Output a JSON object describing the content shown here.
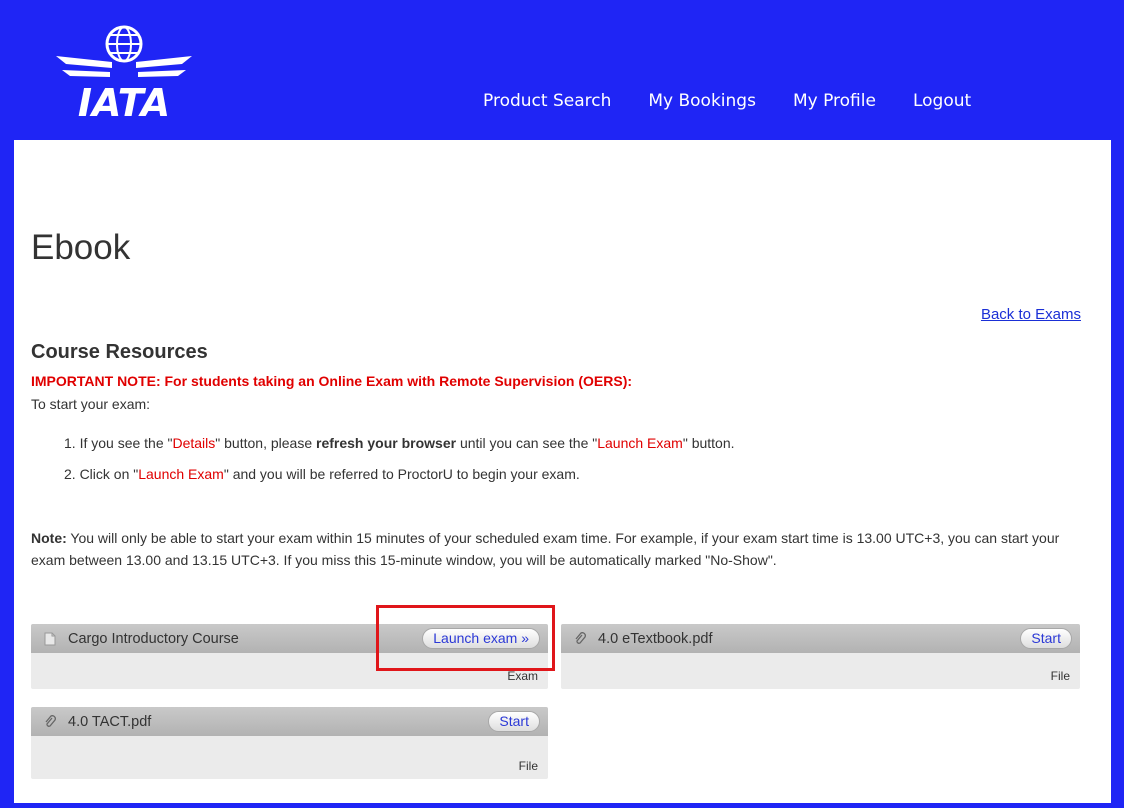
{
  "header": {
    "logo_text": "IATA",
    "nav": [
      "Product Search",
      "My Bookings",
      "My Profile",
      "Logout"
    ]
  },
  "page": {
    "title": "Ebook",
    "back_link": "Back to Exams",
    "section_title": "Course Resources",
    "important_note": "IMPORTANT NOTE: For students taking an Online Exam with Remote Supervision (OERS):",
    "intro": "To start your exam:",
    "steps": [
      {
        "a": "1. If you see the \"",
        "red1": "Details",
        "b": "\" button, please ",
        "bold": "refresh your browser",
        "c": " until you can see the \"",
        "red2": "Launch Exam",
        "d": "\" button."
      },
      {
        "a": "2. Click on \"",
        "red1": "Launch Exam",
        "b": "\" and you will be referred to ProctorU to begin your exam."
      }
    ],
    "note_label": "Note:",
    "note_text": " You will only be able to start your exam within 15 minutes of your scheduled exam time. For example, if your exam start time is 13.00 UTC+3, you can start your exam between 13.00 and 13.15 UTC+3. If you miss this 15-minute window, you will be automatically marked \"No-Show\"."
  },
  "resources": [
    {
      "title": "Cargo Introductory Course",
      "button": "Launch exam »",
      "type": "Exam",
      "icon": "document-icon"
    },
    {
      "title": "4.0 eTextbook.pdf",
      "button": "Start",
      "type": "File",
      "icon": "paperclip-icon"
    },
    {
      "title": "4.0 TACT.pdf",
      "button": "Start",
      "type": "File",
      "icon": "paperclip-icon"
    }
  ],
  "colors": {
    "brand_blue": "#1f25f5",
    "alert_red": "#e00000",
    "highlight_red": "#e0161a",
    "link_blue": "#1a2fd6"
  }
}
